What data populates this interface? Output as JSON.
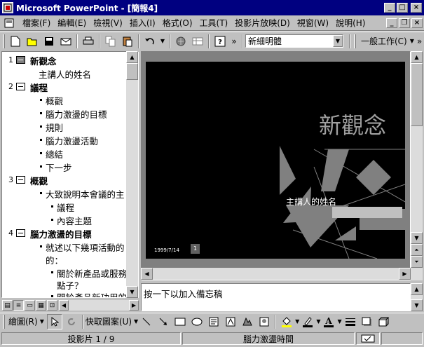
{
  "window": {
    "title": "Microsoft PowerPoint - [簡報4]",
    "app_icon": "powerpoint-icon"
  },
  "menu": {
    "items": [
      "檔案(F)",
      "編輯(E)",
      "檢視(V)",
      "插入(I)",
      "格式(O)",
      "工具(T)",
      "投影片放映(D)",
      "視窗(W)",
      "說明(H)"
    ]
  },
  "toolbar": {
    "more": "»",
    "font_name": "新細明體",
    "common_tasks": "一般工作(C)"
  },
  "outline": {
    "slides": [
      {
        "number": "1",
        "title": "新觀念",
        "subtitle": "主講人的姓名",
        "bullets": []
      },
      {
        "number": "2",
        "title": "議程",
        "bullets": [
          "概觀",
          "腦力激盪的目標",
          "規則",
          "腦力激盪活動",
          "總結",
          "下一步"
        ]
      },
      {
        "number": "3",
        "title": "概觀",
        "bullets": [
          "大致說明本會議的主"
        ],
        "subbullets": [
          "議程",
          "內容主題"
        ]
      },
      {
        "number": "4",
        "title": "腦力激盪的目標",
        "bullets": [
          "就述以下幾項活動的",
          "的："
        ],
        "subbullets": [
          "關於新產品或服務",
          "點子？",
          "關於產品新功用的"
        ]
      }
    ]
  },
  "slide": {
    "title": "新觀念",
    "subtitle": "主講人的姓名",
    "date": "1999/7/14",
    "page_number": "1"
  },
  "notes": {
    "placeholder": "按一下以加入備忘稿"
  },
  "drawing": {
    "draw_label": "繪圖(R)",
    "autoshapes_label": "快取圖案(U)"
  },
  "status": {
    "slide_position": "投影片 1 / 9",
    "design": "腦力激盪時間",
    "spell_icon": "spellcheck-icon"
  },
  "colors": {
    "titlebar": "#000080",
    "slide_background": "#000000",
    "slide_shapes": "#808080"
  }
}
